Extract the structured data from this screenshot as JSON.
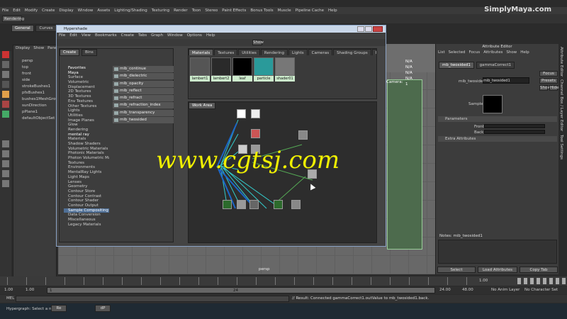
{
  "app": {
    "menus": [
      "File",
      "Edit",
      "Modify",
      "Create",
      "Display",
      "Window",
      "Assets",
      "Lighting/Shading",
      "Texturing",
      "Render",
      "Toon",
      "Stereo",
      "Paint Effects",
      "Bonus Tools",
      "Muscle",
      "Pipeline Cache",
      "Help"
    ],
    "mode": "Rendering",
    "shelf_tabs": [
      "General",
      "Curves"
    ],
    "watermark": "SimplyMaya.com"
  },
  "outliner": {
    "menus": [
      "Display",
      "Show",
      "Panels"
    ],
    "items": [
      "persp",
      "top",
      "front",
      "side",
      "strokeBushes1",
      "pfxBushes1",
      "bushes1MeshGroup",
      "sunDirection",
      "pPlane1",
      "defaultObjectSet"
    ]
  },
  "hypershade": {
    "title": "Hypershade",
    "menus": [
      "File",
      "Edit",
      "View",
      "Bookmarks",
      "Create",
      "Tabs",
      "Graph",
      "Window",
      "Options",
      "Help"
    ],
    "show_label": "Show",
    "left_tabs": [
      "Create",
      "Bins"
    ],
    "tree": [
      {
        "label": "Favorites",
        "hdr": true
      },
      {
        "label": "Maya",
        "hdr": true
      },
      {
        "label": "Surface"
      },
      {
        "label": "Volumetric"
      },
      {
        "label": "Displacement"
      },
      {
        "label": "2D Textures"
      },
      {
        "label": "3D Textures"
      },
      {
        "label": "Env Textures"
      },
      {
        "label": "Other Textures"
      },
      {
        "label": "Lights"
      },
      {
        "label": "Utilities"
      },
      {
        "label": "Image Planes"
      },
      {
        "label": "Glow"
      },
      {
        "label": "Rendering"
      },
      {
        "label": "mental ray",
        "hdr": true
      },
      {
        "label": "Materials"
      },
      {
        "label": "Shadow Shaders"
      },
      {
        "label": "Volumetric Materials"
      },
      {
        "label": "Photonic Materials"
      },
      {
        "label": "Photon Volumetric Materi..."
      },
      {
        "label": "Textures"
      },
      {
        "label": "Environments"
      },
      {
        "label": "MentalRay Lights"
      },
      {
        "label": "Light Maps"
      },
      {
        "label": "Lenses"
      },
      {
        "label": "Geometry"
      },
      {
        "label": "Contour Store"
      },
      {
        "label": "Contour Contrast"
      },
      {
        "label": "Contour Shader"
      },
      {
        "label": "Contour Output"
      },
      {
        "label": "Sample Compositing",
        "sel": true
      },
      {
        "label": "Data Conversion"
      },
      {
        "label": "Miscellaneous"
      },
      {
        "label": "Legacy Materials"
      }
    ],
    "nodes": [
      "mib_continue",
      "mib_dielectric",
      "mib_opacity",
      "mib_reflect",
      "mib_refract",
      "mib_refraction_index",
      "mib_transparency",
      "mib_twosided"
    ],
    "tabs": [
      "Materials",
      "Textures",
      "Utilities",
      "Rendering",
      "Lights",
      "Cameras",
      "Shading Groups",
      "Bake Sets",
      "Projects",
      "As"
    ],
    "swatches": [
      "lambert1",
      "lambert2",
      "leaf",
      "particle",
      "shader01"
    ],
    "work_area_tab": "Work Area"
  },
  "viewport": {
    "hud": [
      "N/A",
      "N/A",
      "N/A",
      "N/A",
      "1"
    ],
    "hud_label": "Camera:",
    "camera": "persp"
  },
  "attr": {
    "title": "Attribute Editor",
    "menus": [
      "List",
      "Selected",
      "Focus",
      "Attributes",
      "Show",
      "Help"
    ],
    "node_tabs": [
      "mb_twosided1",
      "gammaCorrect1"
    ],
    "node_label": "mib_twosided:",
    "node_value": "mib_twosided1",
    "buttons_right": [
      "Focus",
      "Presets",
      "Show",
      "Hide"
    ],
    "sample_label": "Sample",
    "sections": [
      "Parameters",
      "Extra Attributes"
    ],
    "params": [
      "Front",
      "Back"
    ],
    "notes": "Notes: mib_twosided1",
    "bottom_buttons": [
      "Select",
      "Load Attributes",
      "Copy Tab"
    ],
    "side_tabs": [
      "Attribute Editor",
      "Channel Box / Layer Editor",
      "Tool Settings"
    ]
  },
  "timeline": {
    "start": "1.00",
    "current": "1.00",
    "marker": "1",
    "end_marker": "24",
    "range_end": "24.00",
    "max": "48.00",
    "anim_layer": "No Anim Layer",
    "char_set": "No Character Set",
    "frame_right": "1.00"
  },
  "command": {
    "mel": "MEL",
    "result": "// Result: Connected gammaCorrect1.outValue to mb_twosided1.back."
  },
  "taskbar": {
    "status": "Hypergraph: Select a node.",
    "items": [
      "Re",
      "dP"
    ]
  },
  "overlay": "www.cgtsj.com"
}
